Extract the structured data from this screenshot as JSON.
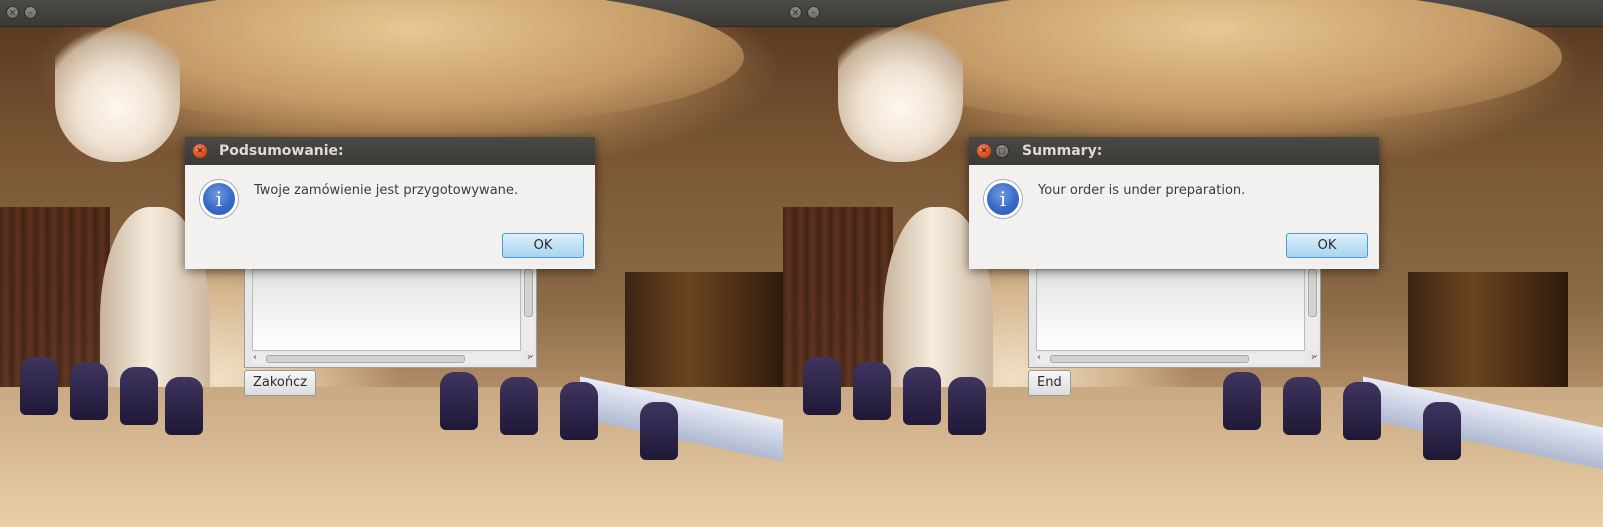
{
  "windows": [
    {
      "dialog": {
        "title": "Podsumowanie:",
        "message": "Twoje zamówienie jest przygotowywane.",
        "ok_label": "OK",
        "has_maximize": false
      },
      "background": {
        "end_button_label": "Zakończ"
      },
      "icons": {
        "titlebar_close": "close-icon",
        "titlebar_minimize": "minimize-icon",
        "dialog_info": "info-icon"
      }
    },
    {
      "dialog": {
        "title": "Summary:",
        "message": "Your order is under preparation.",
        "ok_label": "OK",
        "has_maximize": true
      },
      "background": {
        "end_button_label": "End"
      },
      "icons": {
        "titlebar_close": "close-icon",
        "titlebar_minimize": "minimize-icon",
        "dialog_info": "info-icon"
      }
    }
  ],
  "colors": {
    "titlebar": "#3b3a36",
    "dialog_bg": "#f2f1f0",
    "ok_button_border": "#4a9bd8",
    "close_button": "#df4b17",
    "info_icon": "#3a6ac7"
  }
}
